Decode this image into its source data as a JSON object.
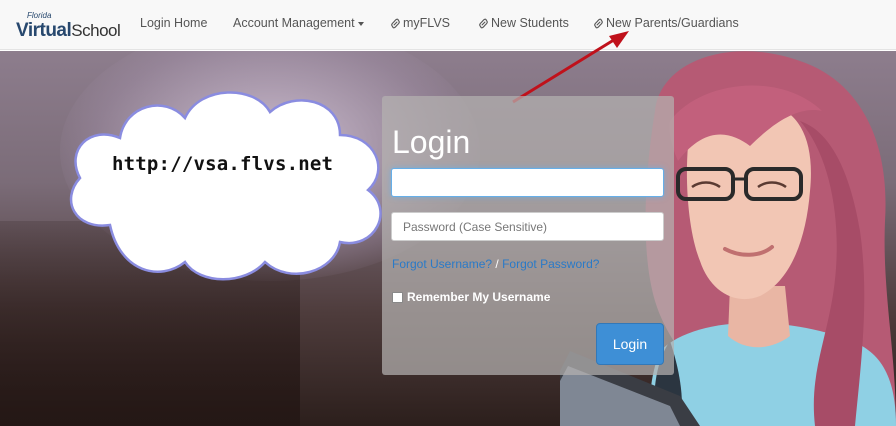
{
  "logo": {
    "small_text": "Florida",
    "virtual_text": "Virtual",
    "school_text": "School",
    "brand_color": "#27486e"
  },
  "nav": {
    "items": [
      {
        "label": "Login Home",
        "icon": null
      },
      {
        "label": "Account Management",
        "icon": "caret-down-icon"
      },
      {
        "label": "myFLVS",
        "icon": "link-icon"
      },
      {
        "label": "New Students",
        "icon": "link-icon"
      },
      {
        "label": "New Parents/Guardians",
        "icon": "link-icon"
      }
    ]
  },
  "cloud": {
    "text": "http://vsa.flvs.net"
  },
  "login": {
    "title": "Login",
    "username_value": "",
    "password_placeholder": "Password (Case Sensitive)",
    "forgot_username": "Forgot Username?",
    "separator": "/",
    "forgot_password": "Forgot Password?",
    "remember_label": "Remember My Username",
    "remember_checked": false,
    "button_label": "Login",
    "button_color": "#3e8fd6",
    "link_color": "#2a7ac7"
  },
  "annotation": {
    "arrow_color": "#c0111b"
  }
}
